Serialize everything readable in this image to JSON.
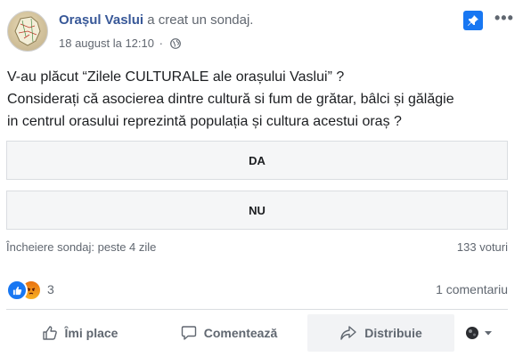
{
  "post": {
    "author": "Orașul Vaslui",
    "action": "a creat un sondaj.",
    "date": "18 august la 12:10",
    "more": "•••",
    "text_line1": "V-au plăcut “Zilele CULTURALE ale orașului Vaslui” ?",
    "text_line2": "Considerați că asocierea dintre cultură si fum de grătar, bâlci și gălăgie",
    "text_line3": "in centrul orasului reprezintă populația și cultura acestui oraș ?"
  },
  "poll": {
    "options": [
      "DA",
      "NU"
    ],
    "end": "Încheiere sondaj: peste 4 zile",
    "votes": "133 voturi"
  },
  "reactions": {
    "count": "3",
    "comments": "1 comentariu"
  },
  "actions": {
    "like": "Îmi place",
    "comment": "Comentează",
    "share": "Distribuie"
  },
  "icons": {
    "pin": "pin-icon",
    "globe": "globe-icon",
    "like_outline": "thumbs-up-icon",
    "comment": "comment-bubble-icon",
    "share": "share-arrow-icon",
    "like_reaction": "like-reaction-icon",
    "angry_reaction": "angry-reaction-icon",
    "audience": "page-avatar-dropdown-icon"
  },
  "colors": {
    "link": "#385898",
    "accent": "#1877f2",
    "muted": "#606770",
    "border": "#dadde1",
    "option_bg": "#f5f6f7"
  }
}
